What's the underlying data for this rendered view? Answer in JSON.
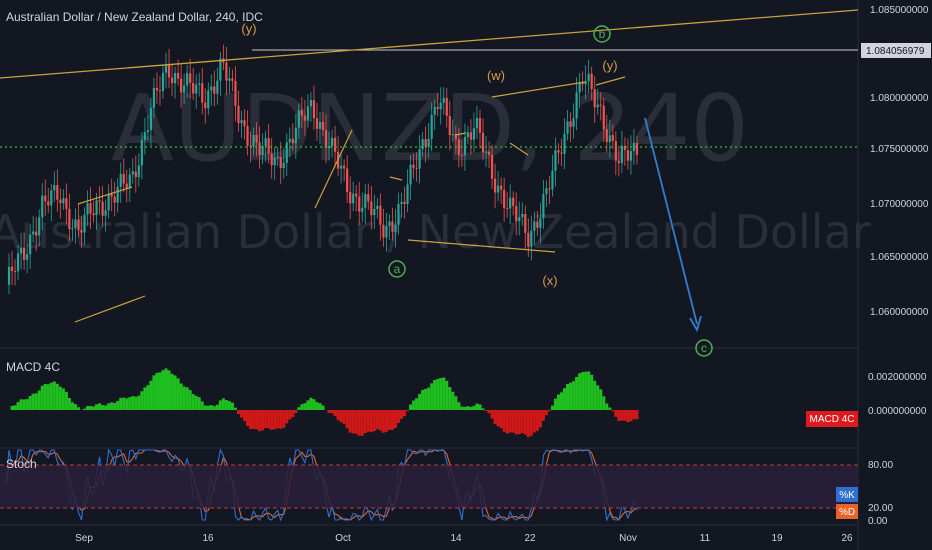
{
  "header": {
    "title": "Australian Dollar / New Zealand Dollar, 240, IDC"
  },
  "watermark": {
    "symbol": "AUDNZD, 240",
    "description": "Australian Dollar / New Zealand Dollar"
  },
  "colors": {
    "background": "#131722",
    "up_candle": "#26a69a",
    "down_candle": "#ef5350",
    "wave_lines": "#c9a23c",
    "green_label": "#4caf50",
    "orange_label": "#d99b4a",
    "projection_arrow": "#2f7fd1",
    "hline_dotted": "#26c626",
    "macd_pos": "#1fbf1f",
    "macd_neg": "#d01818",
    "stoch_k": "#2f6fd0",
    "stoch_d": "#e8622a",
    "stoch_band": "#2a1f3a",
    "stoch_lines": "#c43b3b"
  },
  "price_axis": {
    "ticks": [
      "1.085000000",
      "1.080000000",
      "1.075000000",
      "1.070000000",
      "1.065000000",
      "1.060000000"
    ],
    "current_price": "1.084056979"
  },
  "time_axis": {
    "ticks": [
      "Sep",
      "16",
      "Oct",
      "14",
      "22",
      "Nov",
      "11",
      "19",
      "26"
    ]
  },
  "wave_labels": {
    "y_left": "(y)",
    "b": "b",
    "w": "(w)",
    "y_right": "(y)",
    "a": "a",
    "x": "(x)",
    "c": "c"
  },
  "macd": {
    "title": "MACD 4C",
    "ticks": [
      "0.002000000",
      "0.000000000"
    ],
    "badge": "MACD 4C"
  },
  "stoch": {
    "title": "Stoch",
    "ticks": [
      "80.00",
      "20.00",
      "0.00"
    ],
    "badge_k": "%K",
    "badge_d": "%D"
  },
  "chart_data": {
    "type": "candlestick",
    "symbol": "AUDNZD",
    "timeframe": "240",
    "x_labels": [
      "Sep",
      "16",
      "Oct",
      "14",
      "22",
      "Nov",
      "11",
      "19",
      "26"
    ],
    "ylim": [
      1.0555,
      1.0885
    ],
    "close_path": [
      [
        "Aug 28",
        1.0615
      ],
      [
        "Aug 30",
        1.0645
      ],
      [
        "Sep 2",
        1.069
      ],
      [
        "Sep 4",
        1.07
      ],
      [
        "Sep 6",
        1.0665
      ],
      [
        "Sep 9",
        1.069
      ],
      [
        "Sep 11",
        1.07
      ],
      [
        "Sep 13",
        1.0715
      ],
      [
        "Sep 16",
        1.078
      ],
      [
        "Sep 17",
        1.082
      ],
      [
        "Sep 19",
        1.0805
      ],
      [
        "Sep 20",
        1.079
      ],
      [
        "Sep 23",
        1.0825
      ],
      [
        "Sep 24",
        1.077
      ],
      [
        "Sep 26",
        1.0745
      ],
      [
        "Sep 27",
        1.073
      ],
      [
        "Sep 30",
        1.076
      ],
      [
        "Oct 1",
        1.0785
      ],
      [
        "Oct 2",
        1.0745
      ],
      [
        "Oct 4",
        1.0705
      ],
      [
        "Oct 7",
        1.069
      ],
      [
        "Oct 9",
        1.0668
      ],
      [
        "Oct 11",
        1.069
      ],
      [
        "Oct 14",
        1.0745
      ],
      [
        "Oct 16",
        1.079
      ],
      [
        "Oct 17",
        1.0745
      ],
      [
        "Oct 18",
        1.0765
      ],
      [
        "Oct 21",
        1.072
      ],
      [
        "Oct 23",
        1.0685
      ],
      [
        "Oct 24",
        1.0662
      ],
      [
        "Oct 25",
        1.07
      ],
      [
        "Oct 28",
        1.076
      ],
      [
        "Oct 30",
        1.081
      ],
      [
        "Oct 31",
        1.078
      ],
      [
        "Nov 1",
        1.073
      ],
      [
        "Nov 3",
        1.0745
      ]
    ],
    "horizontal_levels": [
      1.084056979,
      1.0752
    ],
    "projection": {
      "from": [
        "Nov 3",
        1.078
      ],
      "to": [
        "Nov 9",
        1.0585
      ]
    },
    "macd_histogram_range": [
      -0.0015,
      0.0025
    ],
    "stoch_levels": [
      80,
      20
    ]
  }
}
